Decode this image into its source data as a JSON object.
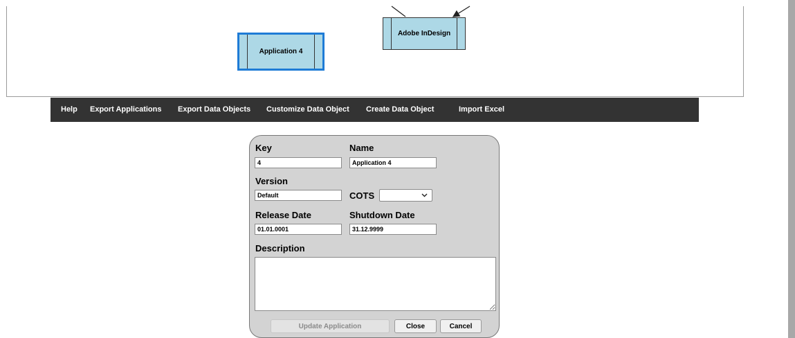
{
  "diagram": {
    "nodes": [
      {
        "label": "Adobe InDesign",
        "selected": false
      },
      {
        "label": "Application 4",
        "selected": true
      }
    ]
  },
  "menu": {
    "items": [
      "Help",
      "Export Applications",
      "Export Data Objects",
      "Customize Data Object",
      "Create Data Object",
      "Import Excel"
    ]
  },
  "form": {
    "key_label": "Key",
    "key_value": "4",
    "name_label": "Name",
    "name_value": "Application 4",
    "version_label": "Version",
    "version_value": "Default",
    "cots_label": "COTS",
    "cots_value": "",
    "release_label": "Release Date",
    "release_value": "01.01.0001",
    "shutdown_label": "Shutdown Date",
    "shutdown_value": "31.12.9999",
    "description_label": "Description",
    "description_value": "",
    "update_button": "Update Application",
    "close_button": "Close",
    "cancel_button": "Cancel"
  },
  "icons": {
    "dropdown": "chevron-down-icon",
    "resize": "resize-grip-icon"
  }
}
